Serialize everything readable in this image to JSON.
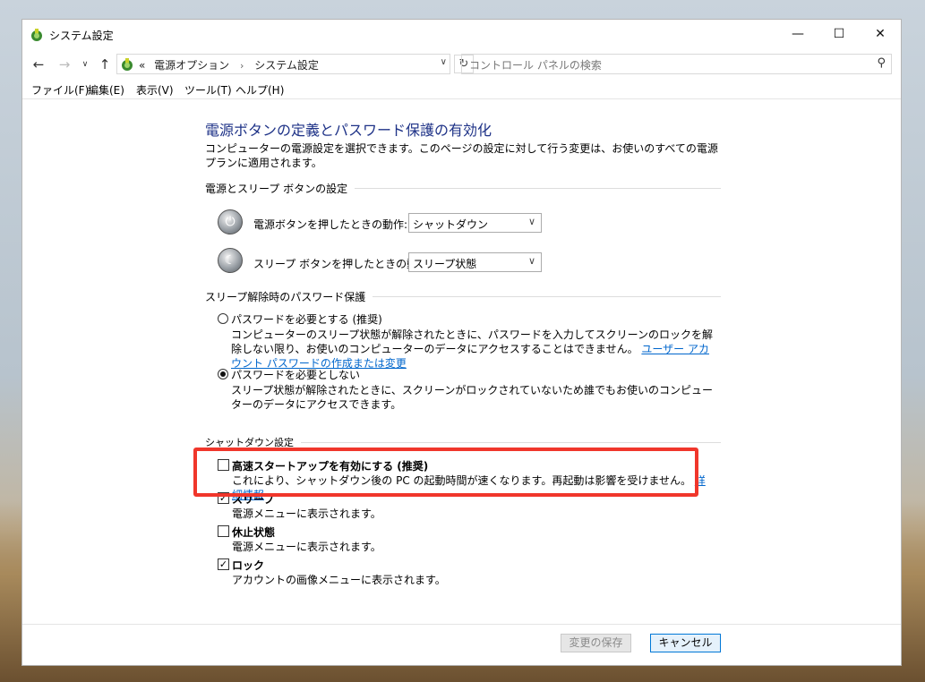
{
  "window": {
    "title": "システム設定"
  },
  "nav": {
    "breadcrumb_prefix": "«",
    "breadcrumb": [
      "電源オプション",
      "システム設定"
    ],
    "search_placeholder": "コントロール パネルの検索"
  },
  "menu": [
    "ファイル(F)",
    "編集(E)",
    "表示(V)",
    "ツール(T)",
    "ヘルプ(H)"
  ],
  "page": {
    "title": "電源ボタンの定義とパスワード保護の有効化",
    "description": "コンピューターの電源設定を選択できます。このページの設定に対して行う変更は、お使いのすべての電源プランに適用されます。"
  },
  "power_section": {
    "heading": "電源とスリープ ボタンの設定",
    "power_button_label": "電源ボタンを押したときの動作:",
    "power_button_value": "シャットダウン",
    "sleep_button_label": "スリープ ボタンを押したときの動作:",
    "sleep_button_value": "スリープ状態"
  },
  "password_section": {
    "heading": "スリープ解除時のパスワード保護",
    "require_label": "パスワードを必要とする (推奨)",
    "require_desc": "コンピューターのスリープ状態が解除されたときに、パスワードを入力してスクリーンのロックを解除しない限り、お使いのコンピューターのデータにアクセスすることはできません。",
    "require_link": "ユーザー アカウント パスワードの作成または変更",
    "require_checked": false,
    "norequire_label": "パスワードを必要としない",
    "norequire_desc": "スリープ状態が解除されたときに、スクリーンがロックされていないため誰でもお使いのコンピューターのデータにアクセスできます。",
    "norequire_checked": true
  },
  "shutdown_section": {
    "heading": "シャットダウン設定",
    "fast_startup_label": "高速スタートアップを有効にする (推奨)",
    "fast_startup_desc": "これにより、シャットダウン後の PC の起動時間が速くなります。再起動は影響を受けません。",
    "fast_startup_link": "詳細情報",
    "fast_startup_checked": false,
    "sleep_label": "スリープ",
    "sleep_desc": "電源メニューに表示されます。",
    "sleep_checked": true,
    "hibernate_label": "休止状態",
    "hibernate_desc": "電源メニューに表示されます。",
    "hibernate_checked": false,
    "lock_label": "ロック",
    "lock_desc": "アカウントの画像メニューに表示されます。",
    "lock_checked": true
  },
  "footer": {
    "save_label": "変更の保存",
    "cancel_label": "キャンセル"
  },
  "colors": {
    "title_blue": "#1e3287",
    "link_blue": "#0066cc",
    "highlight_red": "#f0362b"
  }
}
